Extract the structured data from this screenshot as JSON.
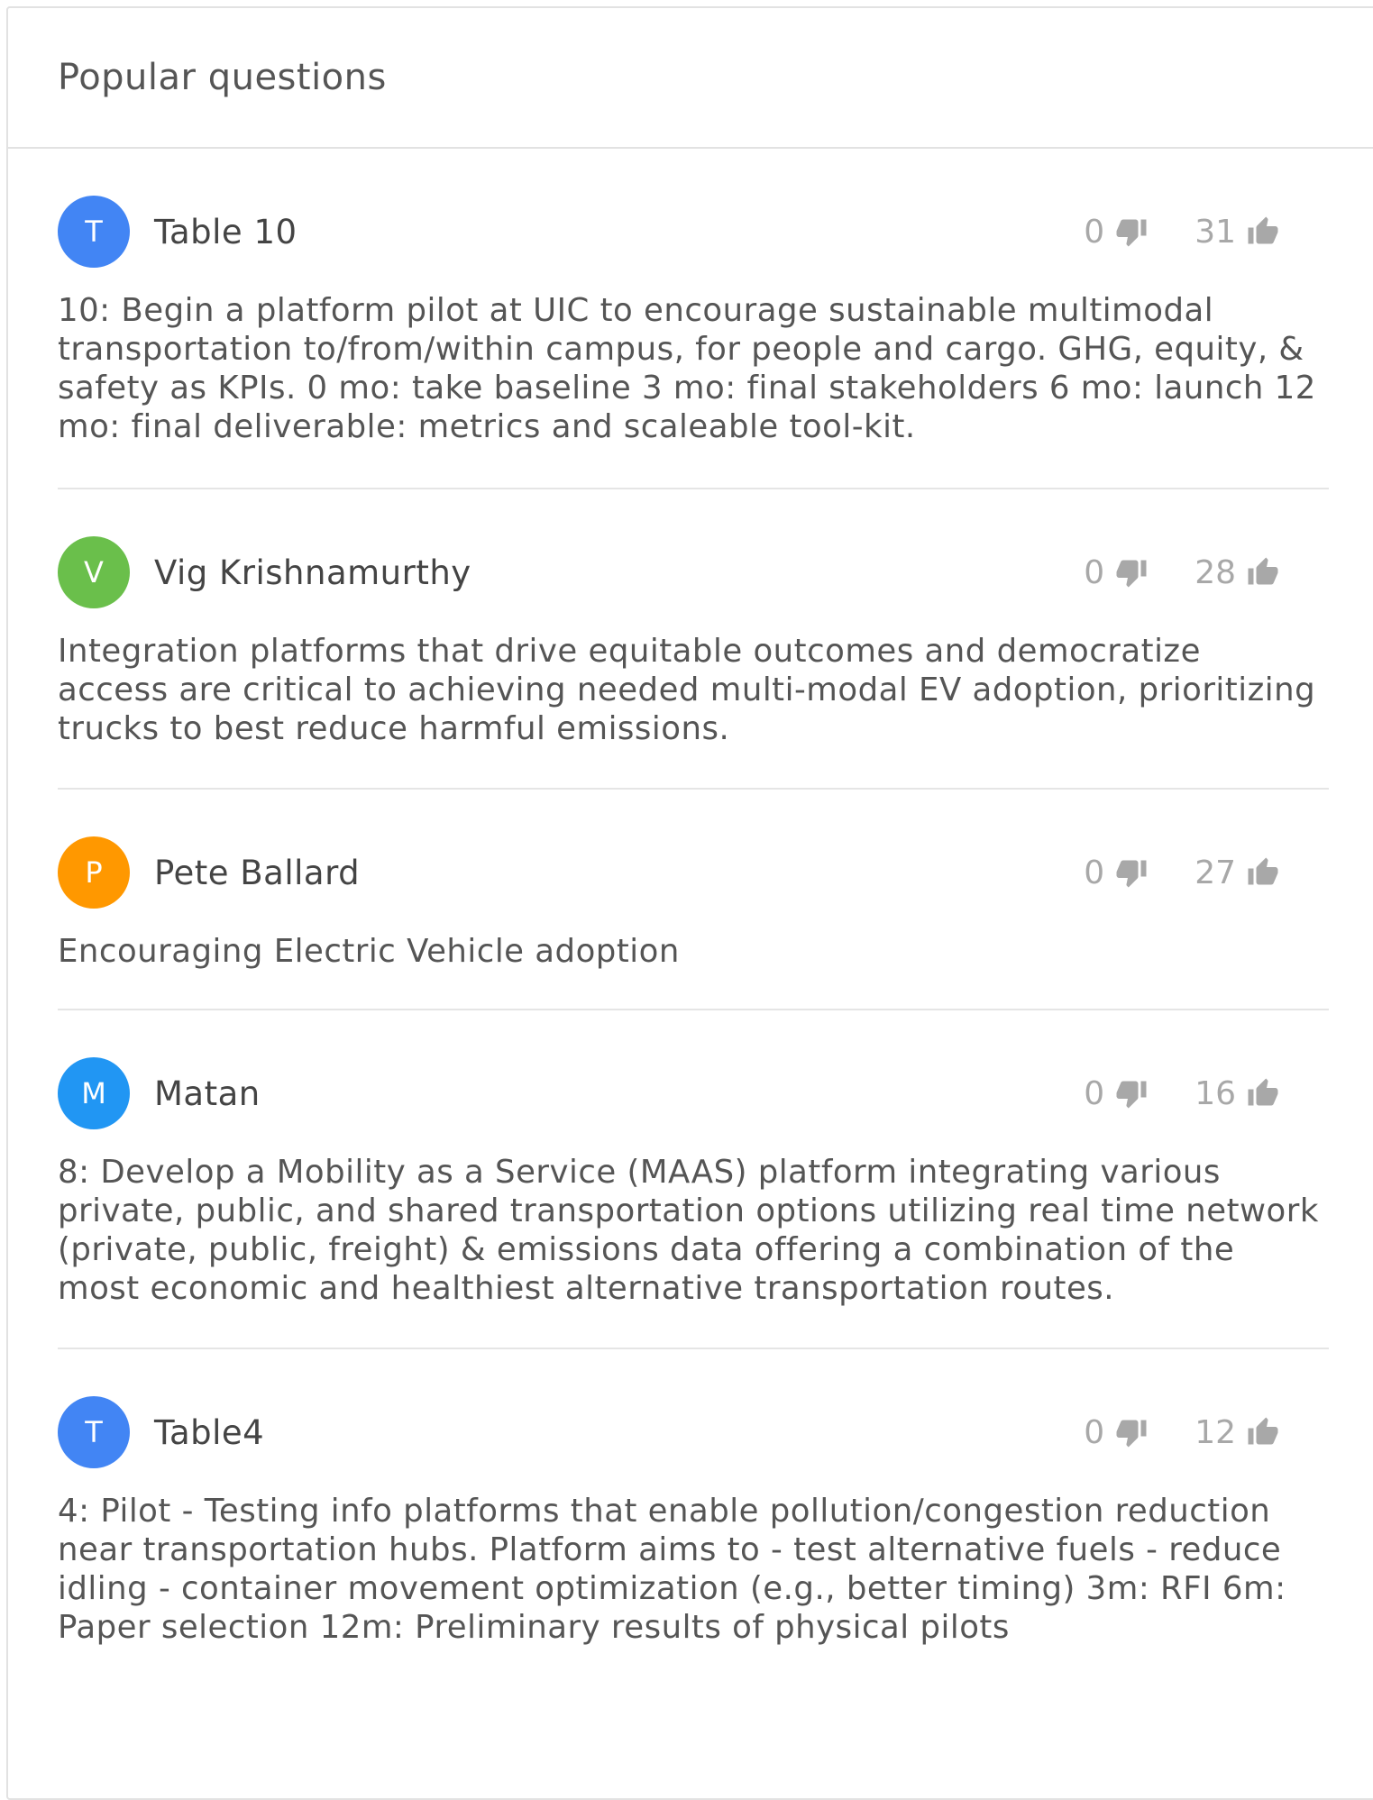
{
  "panel": {
    "title": "Popular questions"
  },
  "colors": {
    "avatar_blue": "#4285f4",
    "avatar_green": "#6abf4b",
    "avatar_orange": "#ff9800",
    "avatar_sky": "#2196f3",
    "vote_gray": "#a8a8a8"
  },
  "questions": [
    {
      "initial": "T",
      "author": "Table 10",
      "downvotes": "0",
      "upvotes": "31",
      "text": "10: Begin a platform pilot at UIC to encourage sustainable multimodal transportation to/from/within campus, for people and cargo. GHG, equity, & safety as KPIs. 0 mo: take baseline 3 mo: final stakeholders 6 mo: launch 12 mo: final deliverable: metrics and scaleable tool-kit."
    },
    {
      "initial": "V",
      "author": "Vig Krishnamurthy",
      "downvotes": "0",
      "upvotes": "28",
      "text": "Integration platforms that drive equitable outcomes and democratize access are critical to achieving needed multi-modal EV adoption, prioritizing trucks to best reduce harmful emissions."
    },
    {
      "initial": "P",
      "author": "Pete Ballard",
      "downvotes": "0",
      "upvotes": "27",
      "text": "Encouraging Electric Vehicle adoption"
    },
    {
      "initial": "M",
      "author": "Matan",
      "downvotes": "0",
      "upvotes": "16",
      "text": "8: Develop a Mobility as a Service (MAAS) platform integrating various private, public, and shared transportation options utilizing real time network (private, public, freight) & emissions data offering a combination of the most economic and healthiest alternative transportation routes."
    },
    {
      "initial": "T",
      "author": "Table4",
      "downvotes": "0",
      "upvotes": "12",
      "text": "4: Pilot - Testing info platforms that enable pollution/congestion reduction near transportation hubs. Platform aims to - test alternative fuels - reduce idling - container movement optimization (e.g., better timing) 3m: RFI 6m: Paper selection 12m: Preliminary results of physical pilots"
    }
  ]
}
